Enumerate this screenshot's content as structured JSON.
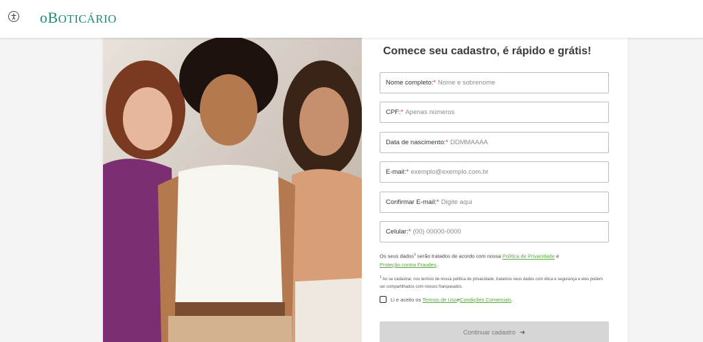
{
  "header": {
    "logo_prefix": "o",
    "logo_b": "B",
    "logo_rest": "oticário",
    "logo_color": "#1f8a79"
  },
  "form": {
    "title": "Comece seu cadastro, é rápido e grátis!",
    "fields": [
      {
        "label": "Nome completo:",
        "required": "*",
        "placeholder": "Nome e sobrenome"
      },
      {
        "label": "CPF:",
        "required": "*",
        "placeholder": "Apenas números"
      },
      {
        "label": "Data de nascimento:",
        "required": "*",
        "placeholder": "DDMMAAAA"
      },
      {
        "label": "E-mail:",
        "required": "*",
        "placeholder": "exemplo@exemplo.com.br"
      },
      {
        "label": "Confirmar E-mail:",
        "required": "*",
        "placeholder": "Digite aqui"
      },
      {
        "label": "Celular:",
        "required": "*",
        "placeholder": "(00) 00000-0000"
      }
    ],
    "privacy": {
      "text_before": "Os seus dados",
      "sup": "1",
      "text_mid": " serão tratados de acordo com nossa ",
      "privacy_link": "Política de Privacidade",
      "and": " e ",
      "fraud_link": "Proteção contra Fraudes",
      "end": "."
    },
    "note": {
      "sup": "1",
      "text": " Ao se cadastrar, nos termos de nossa política de privacidade, tratamos seus dados com ética e segurança e eles podem ser compartilhados com nossos franqueados."
    },
    "terms": {
      "text_before": "Li e aceito os ",
      "terms_link": "Termos de Uso",
      "and": " e ",
      "commercial_link": "Condições Comerciais",
      "end": "."
    },
    "continue_label": "Continuar cadastro",
    "continue_icon": "arrow-right-icon"
  },
  "colors": {
    "accent_link": "#5aa640",
    "required": "#d32f2f",
    "button_disabled": "#d6d6d6"
  }
}
